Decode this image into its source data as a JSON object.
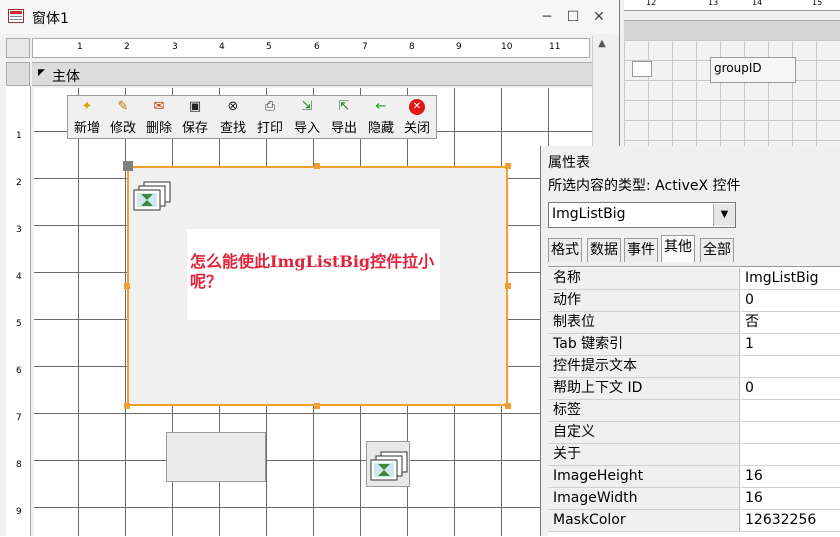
{
  "window": {
    "title": "窗体1",
    "controls": {
      "minimize": "─",
      "maximize": "☐",
      "close": "✕"
    }
  },
  "ruler": {
    "h_ticks": [
      "1",
      "2",
      "3",
      "4",
      "5",
      "6",
      "7",
      "8",
      "9",
      "10",
      "11"
    ],
    "v_ticks": [
      "1",
      "2",
      "3",
      "4",
      "5",
      "6",
      "7",
      "8",
      "9"
    ]
  },
  "section": {
    "label": "主体"
  },
  "toolbar": {
    "buttons": [
      {
        "label": "新增",
        "icon": "new-icon"
      },
      {
        "label": "修改",
        "icon": "edit-icon"
      },
      {
        "label": "删除",
        "icon": "delete-icon"
      },
      {
        "label": "保存",
        "icon": "save-icon"
      },
      {
        "label": "查找",
        "icon": "binoculars-icon"
      },
      {
        "label": "打印",
        "icon": "printer-icon"
      },
      {
        "label": "导入",
        "icon": "import-icon"
      },
      {
        "label": "导出",
        "icon": "export-icon"
      },
      {
        "label": "隐藏",
        "icon": "arrow-left-icon"
      },
      {
        "label": "关闭",
        "icon": "close-circle-icon"
      }
    ]
  },
  "annotation": {
    "text": "怎么能使此ImgListBig控件拉小呢？"
  },
  "background_window": {
    "ruler_ticks": [
      "12",
      "13",
      "14",
      "15"
    ],
    "field_label": "groupID"
  },
  "property_sheet": {
    "title": "属性表",
    "selection_type": "所选内容的类型: ActiveX 控件",
    "selected_object": "ImgListBig",
    "tabs": [
      "格式",
      "数据",
      "事件",
      "其他",
      "全部"
    ],
    "active_tab": "其他",
    "properties": [
      {
        "name": "名称",
        "value": "ImgListBig"
      },
      {
        "name": "动作",
        "value": "0"
      },
      {
        "name": "制表位",
        "value": "否"
      },
      {
        "name": "Tab 键索引",
        "value": "1"
      },
      {
        "name": "控件提示文本",
        "value": ""
      },
      {
        "name": "帮助上下文 ID",
        "value": "0"
      },
      {
        "name": "标签",
        "value": ""
      },
      {
        "name": "自定义",
        "value": ""
      },
      {
        "name": "关于",
        "value": ""
      },
      {
        "name": "ImageHeight",
        "value": "16"
      },
      {
        "name": "ImageWidth",
        "value": "16"
      },
      {
        "name": "MaskColor",
        "value": "12632256"
      }
    ]
  },
  "colors": {
    "selection": "#f0a030",
    "annotation": "#e0243c",
    "grid": "#6a6a6a"
  }
}
